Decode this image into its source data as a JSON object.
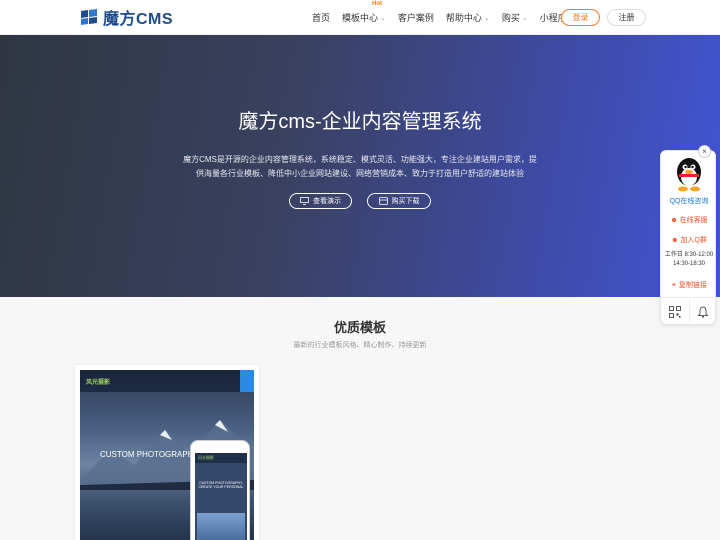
{
  "header": {
    "logo_text": "魔方CMS",
    "nav": [
      {
        "label": "首页"
      },
      {
        "label": "模板中心",
        "badge": "Hot"
      },
      {
        "label": "客户案例"
      },
      {
        "label": "帮助中心"
      },
      {
        "label": "购买"
      },
      {
        "label": "小程序"
      }
    ],
    "login_label": "登录",
    "register_label": "注册"
  },
  "hero": {
    "title": "魔方cms-企业内容管理系统",
    "description": "魔方CMS是开源的企业内容管理系统，系统稳定、模式灵活、功能强大，专注企业建站用户需求，提供海量各行业模板、降低中小企业网站建设、网络营销成本、致力于打造用户舒适的建站体验",
    "demo_label": "查看演示",
    "buy_label": "购买下载"
  },
  "section": {
    "title": "优质模板",
    "subtitle": "最新的行业模板风格、精心制作、持续更新"
  },
  "template_card": {
    "shot_logo": "风光摄影",
    "shot_headline": "CUSTOM PHOTOGRAPHY, CREAT",
    "phone_logo": "风光摄影",
    "phone_text": "CUSTOM PHOTOGRAPHY, CREATE YOUR PERSONAL"
  },
  "float_panel": {
    "qq_label": "QQ在线咨询",
    "online_label": "在线客服",
    "join_label": "加入Q群",
    "hours_line1": "工作日 8:30-12:00",
    "hours_line2": "14:30-18:30",
    "copy_label": "复制链接",
    "close_label": "×"
  },
  "colors": {
    "accent": "#ff7a1a",
    "brand": "#1e4c8c",
    "link": "#1677d3",
    "hero_start": "#2f3642",
    "hero_end": "#4355d6"
  }
}
